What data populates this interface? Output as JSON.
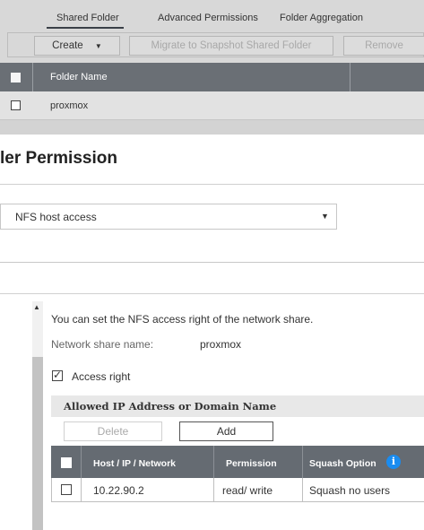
{
  "tabs": [
    "Shared Folder",
    "Advanced Permissions",
    "Folder Aggregation"
  ],
  "toolbar": {
    "create_label": "Create",
    "migrate_label": "Migrate to Snapshot Shared Folder",
    "remove_label": "Remove"
  },
  "folder_table": {
    "column_header": "Folder Name",
    "rows": [
      "proxmox"
    ]
  },
  "dialog": {
    "title": "ler Permission",
    "select_value": "NFS host access",
    "info_text": "You can set the NFS access right of the network share.",
    "share_name_label": "Network share name:",
    "share_name_value": "proxmox",
    "access_right_label": "Access right",
    "access_right_checked": true
  },
  "ip_panel": {
    "title": "Allowed IP Address or Domain Name",
    "delete_label": "Delete",
    "add_label": "Add",
    "columns": [
      "Host / IP / Network",
      "Permission",
      "Squash Option"
    ],
    "rows": [
      {
        "host": "10.22.90.2",
        "permission": "read/ write",
        "squash": "Squash no users"
      }
    ]
  },
  "colors": {
    "header_bg": "#6a6f75",
    "info_icon": "#1a8cf0"
  }
}
